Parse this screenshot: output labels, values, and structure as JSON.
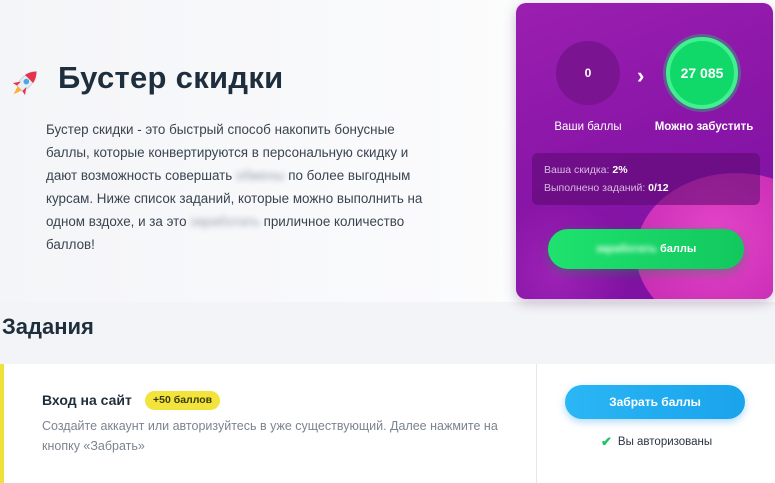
{
  "header": {
    "title": "Бустер скидки",
    "description_parts": {
      "p1": "Бустер скидки - это быстрый способ накопить бонусные баллы, которые конвертируются в персональную скидку и дают возможность совершать ",
      "blur1": "обмены",
      "p2": " по более выгодным курсам. Ниже список заданий, которые можно выполнить на одном вздохе, и за это ",
      "blur2": "заработать",
      "p3": " приличное количество баллов!"
    }
  },
  "card": {
    "score_value": "0",
    "score_label": "Ваши баллы",
    "can_value": "27 085",
    "can_label": "Можно забустить",
    "discount_label": "Ваша скидка:",
    "discount_value": "2%",
    "done_label": "Выполнено заданий:",
    "done_value": "0/12",
    "earn_blur": "заработать",
    "earn_suffix": " баллы"
  },
  "tasks": {
    "heading": "Задания",
    "items": [
      {
        "title": "Вход на сайт",
        "badge": "+50 баллов",
        "description": "Создайте аккаунт или авторизуйтесь в уже существующий. Далее нажмите на кнопку «Забрать»",
        "button": "Забрать баллы",
        "status": "Вы авторизованы"
      }
    ]
  },
  "colors": {
    "card_purple": "#8a16a8",
    "green": "#12c85e",
    "blue": "#1aa3ec",
    "badge_yellow": "#f2e43c"
  }
}
